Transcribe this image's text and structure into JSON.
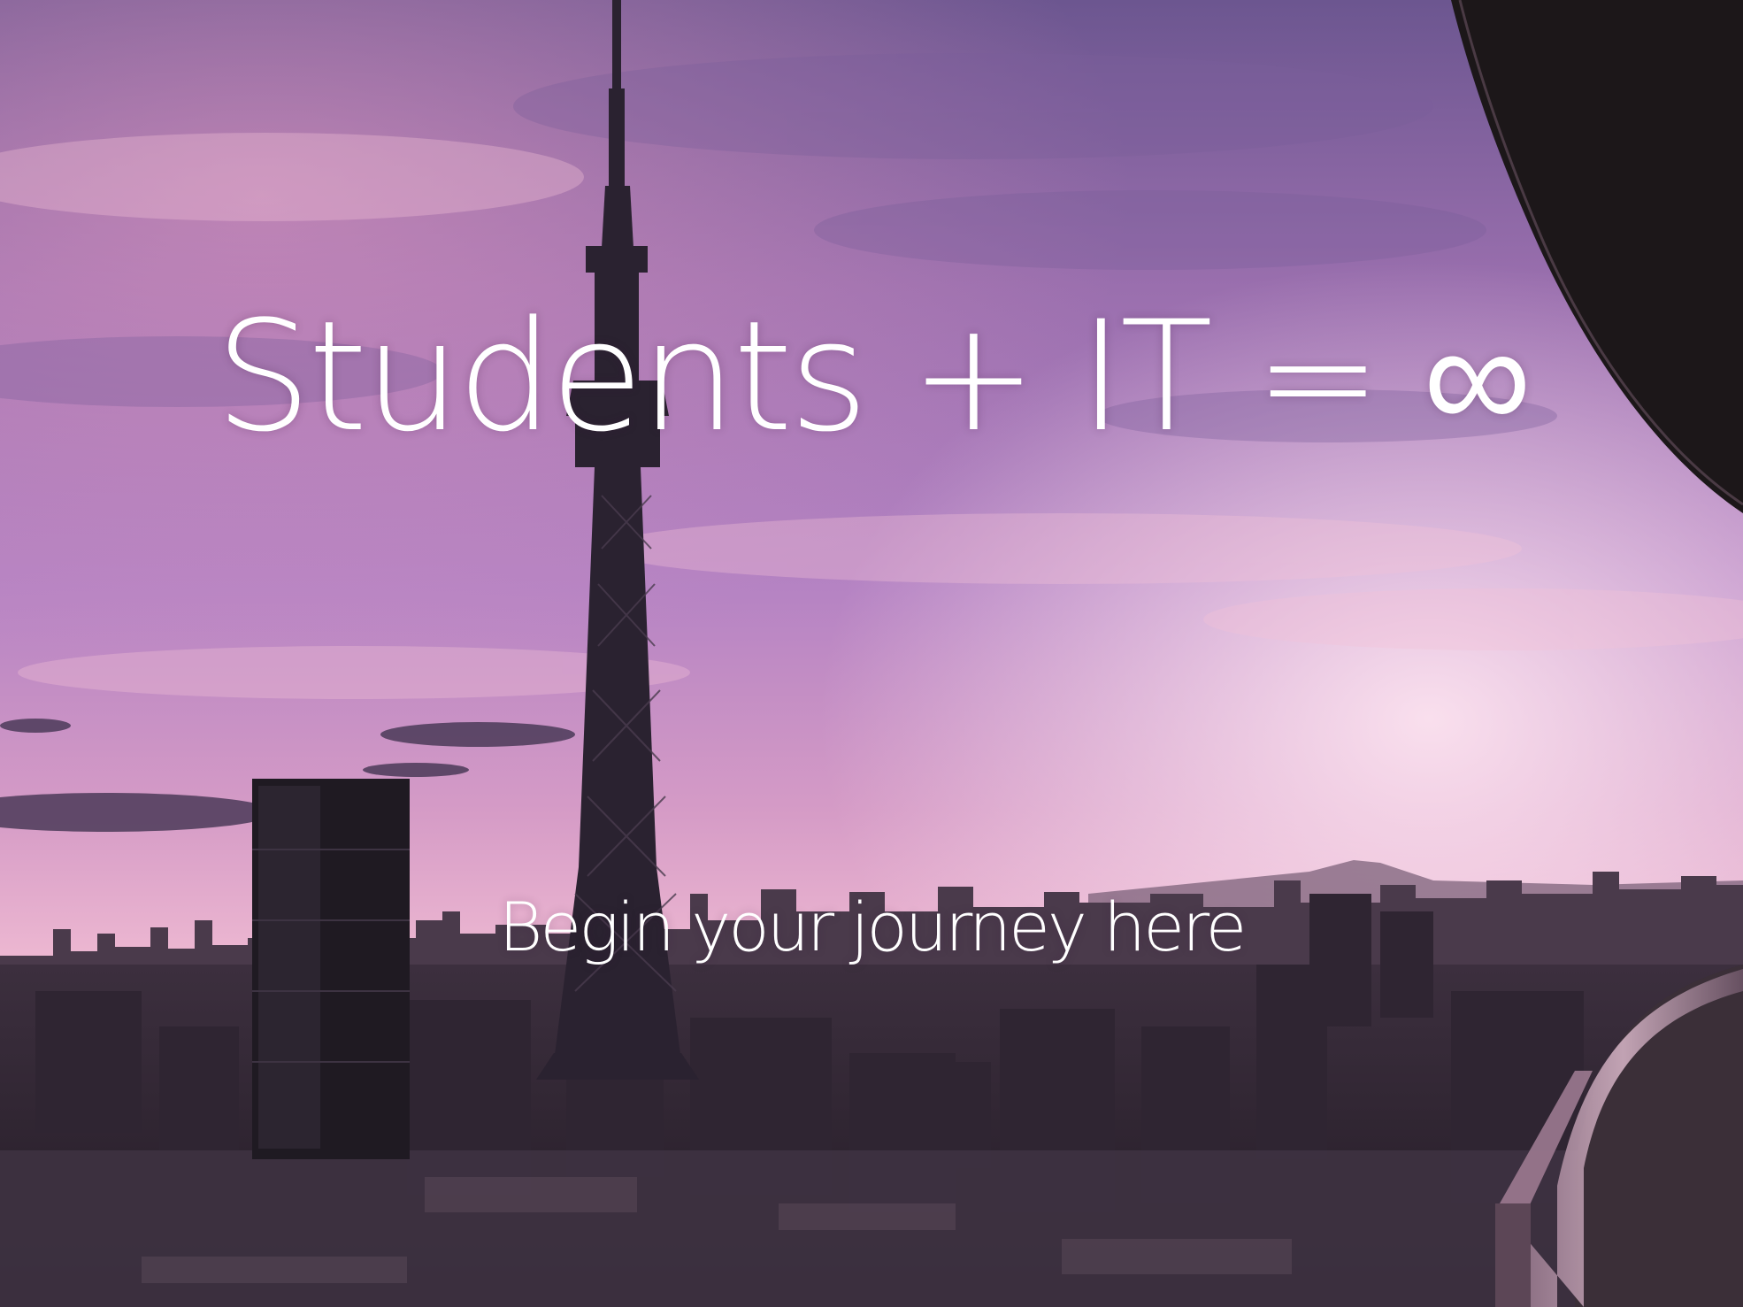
{
  "hero": {
    "headline": "Students + IT = ∞",
    "tagline": "Begin your journey here"
  },
  "colors": {
    "sky_top": "#5e4a86",
    "sky_mid": "#b07cc0",
    "sky_horizon": "#f3c6d8",
    "city": "#2c2230",
    "text": "#ffffff"
  }
}
